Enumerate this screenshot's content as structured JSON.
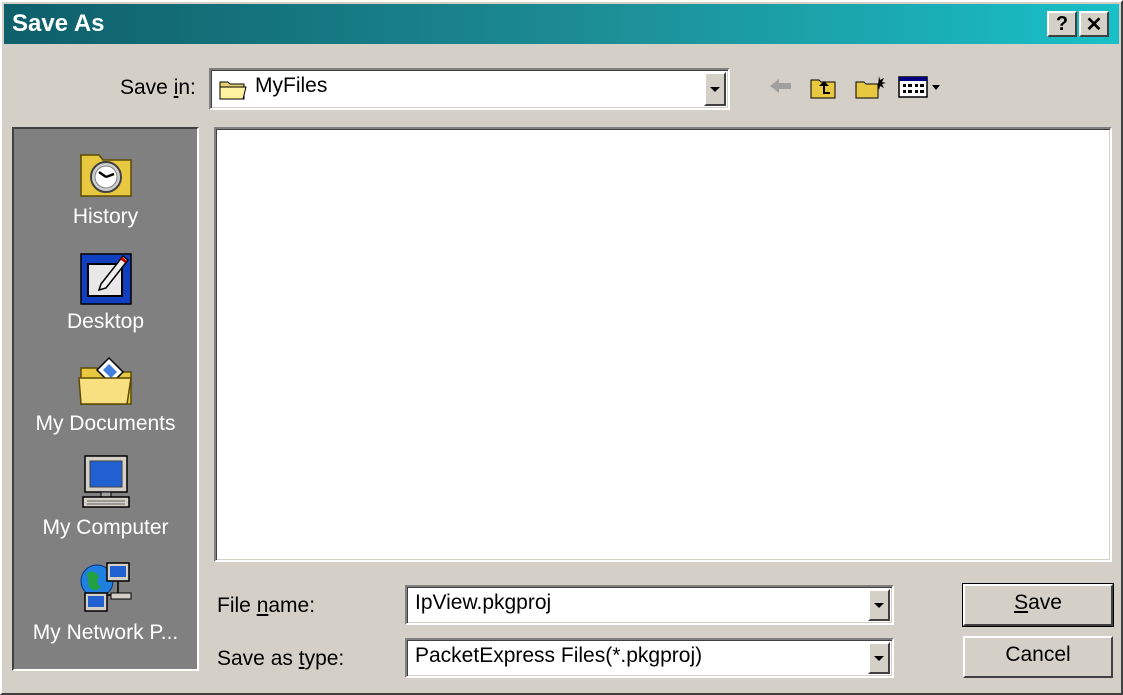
{
  "window": {
    "title": "Save As"
  },
  "caption_buttons": {
    "help": "?",
    "close": "✕"
  },
  "save_in": {
    "label_prefix": "Save ",
    "label_accel": "i",
    "label_suffix": "n:",
    "value": "MyFiles"
  },
  "toolbar": {
    "back_icon": "back-arrow-icon",
    "up_icon": "up-one-level-icon",
    "new_folder_icon": "new-folder-icon",
    "views_icon": "views-menu-icon"
  },
  "places": [
    {
      "label": "History",
      "icon": "history-icon"
    },
    {
      "label": "Desktop",
      "icon": "desktop-icon"
    },
    {
      "label": "My Documents",
      "icon": "my-documents-icon"
    },
    {
      "label": "My Computer",
      "icon": "my-computer-icon"
    },
    {
      "label": "My Network P...",
      "icon": "my-network-places-icon"
    }
  ],
  "file_name": {
    "label_prefix": "File ",
    "label_accel": "n",
    "label_suffix": "ame:",
    "value": "IpView.pkgproj"
  },
  "save_as_type": {
    "label_prefix": "Save as ",
    "label_accel": "t",
    "label_suffix": "ype:",
    "value": "PacketExpress Files(*.pkgproj)"
  },
  "buttons": {
    "save_accel": "S",
    "save_rest": "ave",
    "cancel": "Cancel"
  },
  "colors": {
    "title_gradient_start": "#0e5f6a",
    "title_gradient_end": "#19c0c8",
    "face": "#d4d0c8",
    "places_bar": "#808080"
  }
}
